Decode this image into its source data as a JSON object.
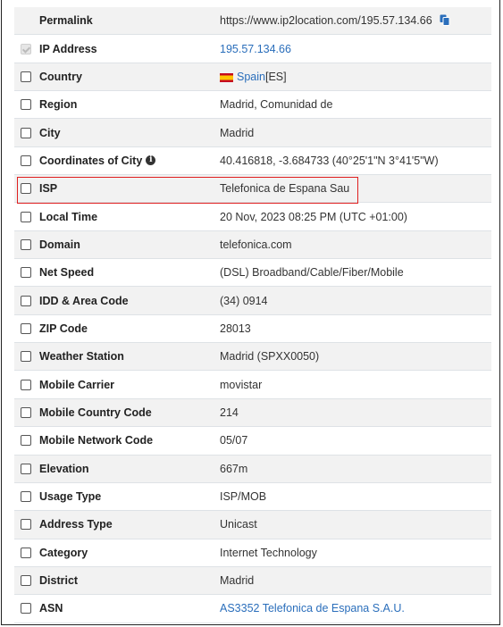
{
  "rows": [
    {
      "label": "Permalink",
      "value": "https://www.ip2location.com/195.57.134.66",
      "checked": false,
      "no_checkbox": true
    },
    {
      "label": "IP Address",
      "value": "195.57.134.66",
      "checked": true
    },
    {
      "label": "Country",
      "value": "Spain",
      "suffix": " [ES]"
    },
    {
      "label": "Region",
      "value": "Madrid, Comunidad de"
    },
    {
      "label": "City",
      "value": "Madrid"
    },
    {
      "label": "Coordinates of City",
      "value": "40.416818, -3.684733 (40°25'1\"N   3°41'5\"W)"
    },
    {
      "label": "ISP",
      "value": "Telefonica de Espana Sau"
    },
    {
      "label": "Local Time",
      "value": "20 Nov, 2023 08:25 PM (UTC +01:00)"
    },
    {
      "label": "Domain",
      "value": "telefonica.com"
    },
    {
      "label": "Net Speed",
      "value": "(DSL) Broadband/Cable/Fiber/Mobile"
    },
    {
      "label": "IDD & Area Code",
      "value": "(34) 0914"
    },
    {
      "label": "ZIP Code",
      "value": "28013"
    },
    {
      "label": "Weather Station",
      "value": "Madrid (SPXX0050)"
    },
    {
      "label": "Mobile Carrier",
      "value": "movistar"
    },
    {
      "label": "Mobile Country Code",
      "value": "214"
    },
    {
      "label": "Mobile Network Code",
      "value": "05/07"
    },
    {
      "label": "Elevation",
      "value": "667m"
    },
    {
      "label": "Usage Type",
      "value": "ISP/MOB"
    },
    {
      "label": "Address Type",
      "value": "Unicast"
    },
    {
      "label": "Category",
      "value": "Internet Technology"
    },
    {
      "label": "District",
      "value": "Madrid"
    },
    {
      "label": "ASN",
      "value": "AS3352 Telefonica de Espana S.A.U."
    }
  ],
  "icons": {
    "copy": "copy-icon",
    "info": "info-icon",
    "flag": "spain-flag-icon"
  },
  "info_glyph": "i",
  "colors": {
    "link": "#2a6ebb",
    "highlight_border": "#e02020",
    "row_alt": "#f2f2f2"
  }
}
